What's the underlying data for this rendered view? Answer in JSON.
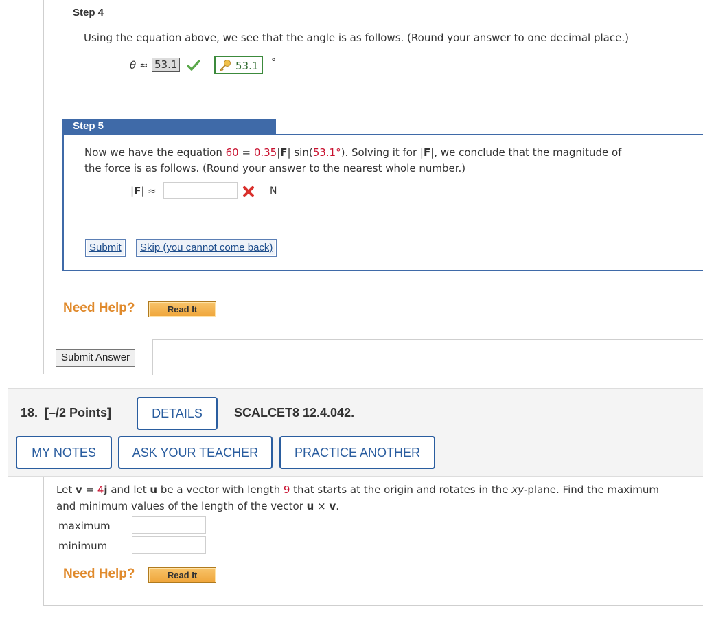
{
  "step4": {
    "label": "Step 4",
    "instruction": "Using the equation above, we see that the angle is as follows. (Round your answer to one decimal place.)",
    "theta_symbol": "θ ≈",
    "entered_value": "53.1",
    "key_value": "53.1",
    "unit": "°"
  },
  "step5": {
    "label": "Step 5",
    "line1_a": "Now we have the equation ",
    "eq_60": "60",
    "eq_equals": " = ",
    "eq_coef": "0.35",
    "eq_bar1": "|",
    "eq_F": "F",
    "eq_bar2": "| sin(",
    "eq_angle": "53.1°",
    "line1_b": "). Solving it for ",
    "solve_bar1": "|",
    "solve_F": "F",
    "solve_bar2": "|",
    "line1_c": ", we conclude that the magnitude of",
    "line2": "the force is as follows. (Round your answer to the nearest whole number.)",
    "mag_label_bar1": "|",
    "mag_label_F": "F",
    "mag_label_bar2": "| ≈",
    "mag_value": "",
    "unit": "N",
    "submit_label": "Submit",
    "skip_label": "Skip (you cannot come back)"
  },
  "help": {
    "need_help": "Need Help?",
    "read_it": "Read It"
  },
  "submit_answer_label": "Submit Answer",
  "q18": {
    "title": "18.  [–/2 Points]",
    "details_label": "DETAILS",
    "code": "SCALCET8 12.4.042.",
    "my_notes_label": "MY NOTES",
    "ask_teacher_label": "ASK YOUR TEACHER",
    "practice_label": "PRACTICE ANOTHER",
    "p_let": "Let ",
    "p_v": "v",
    "p_eq": " = ",
    "p_4": "4",
    "p_j": "j",
    "p_and_let": " and let ",
    "p_u": "u",
    "p_len": " be a vector with length ",
    "p_9": "9",
    "p_rest": " that starts at the origin and rotates in the ",
    "p_xy": "xy",
    "p_plane": "-plane. Find the maximum",
    "p_line2a": "and minimum values of the length of the vector ",
    "p_u2": "u",
    "p_times": " × ",
    "p_v2": "v",
    "p_dot": ".",
    "maximum_label": "maximum",
    "minimum_label": "minimum",
    "maximum_value": "",
    "minimum_value": "",
    "need_help": "Need Help?",
    "read_it": "Read It"
  },
  "colors": {
    "step_header": "#3f6aa8",
    "red_value": "#c8102e",
    "need_help": "#e08a2c",
    "correct_green": "#5aa84a",
    "wrong_red": "#d9302c",
    "button_blue": "#2a5d9f"
  },
  "icons": {
    "check": "check-icon",
    "cross": "cross-icon",
    "key": "key-icon"
  }
}
